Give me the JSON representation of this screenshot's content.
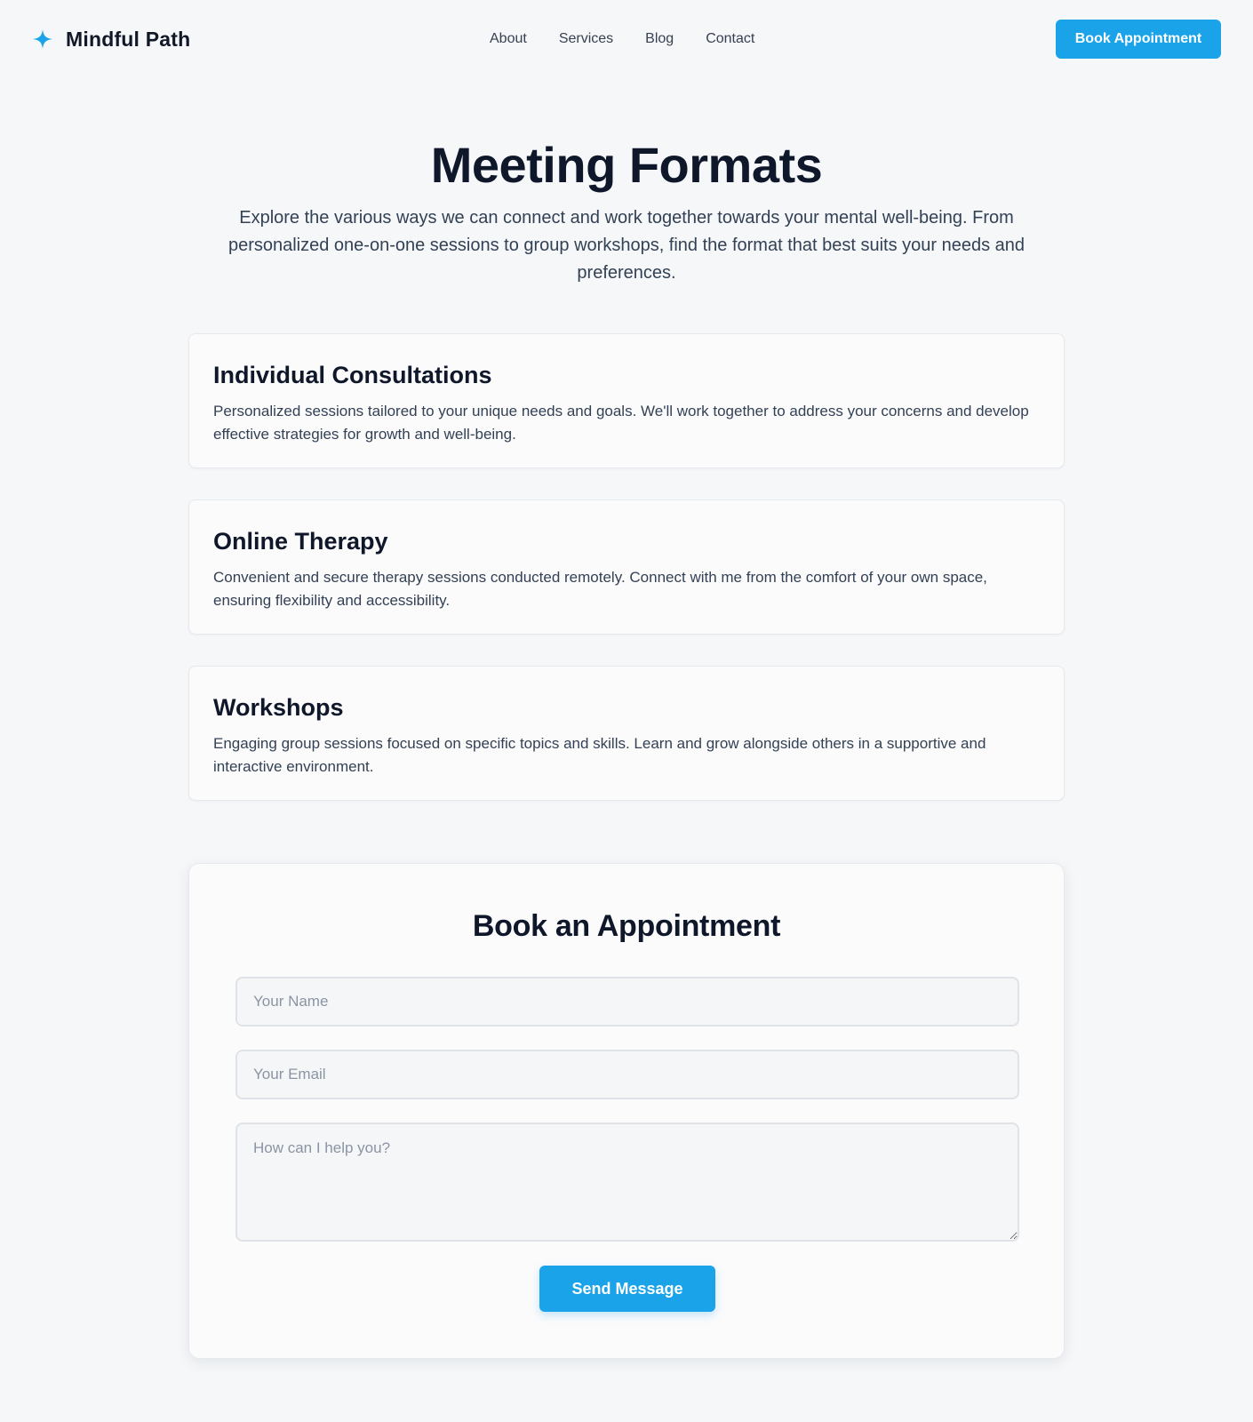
{
  "header": {
    "brand_name": "Mindful Path",
    "brand_icon": "sparkle-icon",
    "nav": [
      {
        "label": "About"
      },
      {
        "label": "Services"
      },
      {
        "label": "Blog"
      },
      {
        "label": "Contact"
      }
    ],
    "cta_label": "Book Appointment"
  },
  "hero": {
    "title": "Meeting Formats",
    "description": "Explore the various ways we can connect and work together towards your mental well-being. From personalized one-on-one sessions to group workshops, find the format that best suits your needs and preferences."
  },
  "formats": [
    {
      "title": "Individual Consultations",
      "description": "Personalized sessions tailored to your unique needs and goals. We'll work together to address your concerns and develop effective strategies for growth and well-being."
    },
    {
      "title": "Online Therapy",
      "description": "Convenient and secure therapy sessions conducted remotely. Connect with me from the comfort of your own space, ensuring flexibility and accessibility."
    },
    {
      "title": "Workshops",
      "description": "Engaging group sessions focused on specific topics and skills. Learn and grow alongside others in a supportive and interactive environment."
    }
  ],
  "booking": {
    "title": "Book an Appointment",
    "name_placeholder": "Your Name",
    "email_placeholder": "Your Email",
    "message_placeholder": "How can I help you?",
    "submit_label": "Send Message"
  },
  "colors": {
    "accent": "#1aa3e8",
    "background": "#f5f7f9",
    "heading": "#0f172a",
    "body_text": "#334155"
  }
}
